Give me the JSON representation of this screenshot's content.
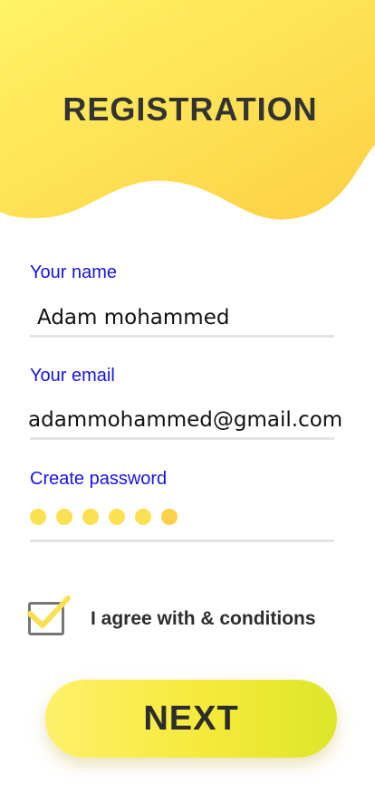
{
  "header": {
    "title": "REGISTRATION",
    "gradient_start": "#fef464",
    "gradient_end": "#fdcf45"
  },
  "form": {
    "name": {
      "label": "Your name",
      "value": "Adam mohammed"
    },
    "email": {
      "label": "Your email",
      "value": "adammohammed@gmail.com"
    },
    "password": {
      "label": "Create password",
      "masked_length": 6
    }
  },
  "agreement": {
    "label": "I agree with & conditions",
    "checked": true
  },
  "next_button": {
    "label": "NEXT"
  },
  "colors": {
    "label_blue": "#1414e6",
    "accent_yellow": "#fbe052",
    "text_dark": "#2d2d2d"
  },
  "icons": [
    "checkmark-icon"
  ]
}
